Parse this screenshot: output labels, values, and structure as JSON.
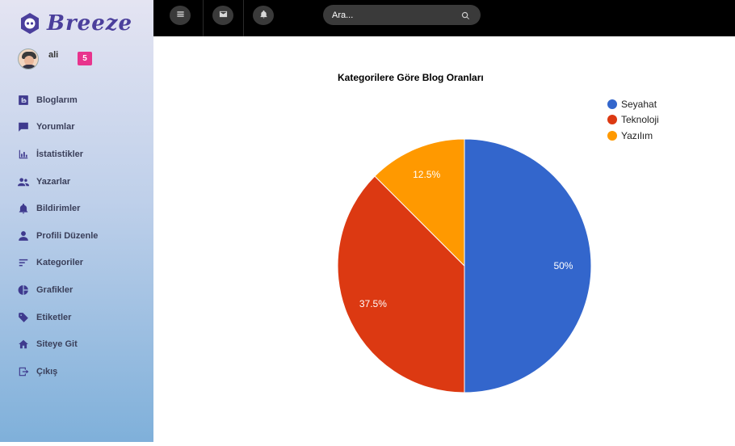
{
  "sidebar": {
    "brand": "Breeze",
    "user": {
      "name": "ali",
      "badge": "5"
    },
    "items": [
      {
        "label": "Bloglarım",
        "icon": "blogger-icon"
      },
      {
        "label": "Yorumlar",
        "icon": "comment-icon"
      },
      {
        "label": "İstatistikler",
        "icon": "bar-chart-icon"
      },
      {
        "label": "Yazarlar",
        "icon": "people-icon"
      },
      {
        "label": "Bildirimler",
        "icon": "bell-icon"
      },
      {
        "label": "Profili Düzenle",
        "icon": "person-icon"
      },
      {
        "label": "Kategoriler",
        "icon": "sort-icon"
      },
      {
        "label": "Grafikler",
        "icon": "pie-chart-icon"
      },
      {
        "label": "Etiketler",
        "icon": "tag-icon"
      },
      {
        "label": "Siteye Git",
        "icon": "home-icon"
      },
      {
        "label": "Çıkış",
        "icon": "exit-icon"
      }
    ],
    "icon_color": "#3f3a8e"
  },
  "topbar": {
    "buttons": [
      "menu-icon",
      "mail-icon",
      "bell-icon"
    ],
    "search": {
      "placeholder": "Ara..."
    }
  },
  "chart_data": {
    "type": "pie",
    "title": "Kategorilere Göre Blog Oranları",
    "categories": [
      "Seyahat",
      "Teknoloji",
      "Yazılım"
    ],
    "values": [
      50,
      37.5,
      12.5
    ],
    "labels": [
      "50%",
      "37.5%",
      "12.5%"
    ],
    "colors": [
      "#3366cc",
      "#dc3912",
      "#ff9900"
    ],
    "legend": "top-right"
  }
}
